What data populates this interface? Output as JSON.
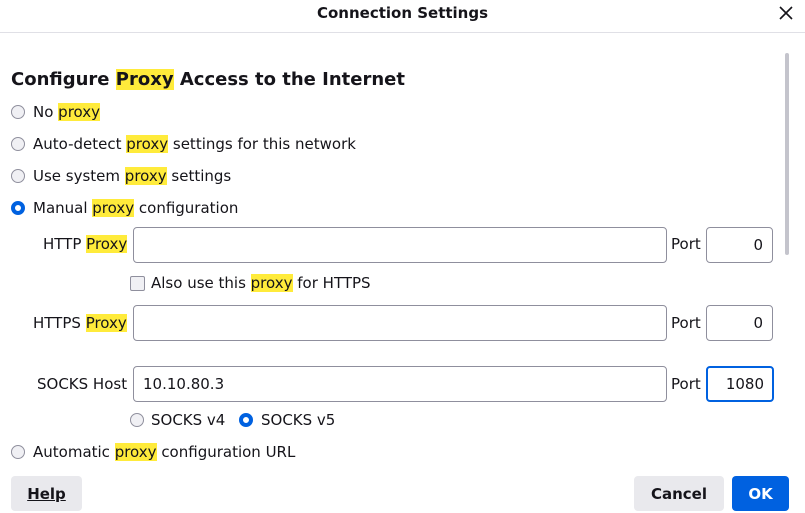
{
  "window": {
    "title": "Connection Settings"
  },
  "heading": {
    "pre": "Configure ",
    "hl": "Proxy",
    "post": " Access to the Internet"
  },
  "options": {
    "no_proxy": {
      "pre": "No ",
      "hl": "proxy",
      "post": "",
      "selected": false
    },
    "auto_detect": {
      "pre": "Auto-detect ",
      "hl": "proxy",
      "post": " settings for this network",
      "selected": false
    },
    "system": {
      "pre": "Use system ",
      "hl": "proxy",
      "post": " settings",
      "selected": false
    },
    "manual": {
      "pre": "Manual ",
      "hl": "proxy",
      "post": " configuration",
      "selected": true
    },
    "auto_url": {
      "pre": "Automatic ",
      "hl": "proxy",
      "post": " configuration URL",
      "selected": false
    }
  },
  "http": {
    "label_pre": "HTTP ",
    "label_hl": "Proxy",
    "host_value": "",
    "port_label": "Port",
    "port_value": "0"
  },
  "also_https": {
    "pre": "Also use this ",
    "hl": "proxy",
    "post": " for HTTPS",
    "checked": false
  },
  "https": {
    "label_pre": "HTTPS ",
    "label_hl": "Proxy",
    "host_value": "",
    "port_label": "Port",
    "port_value": "0"
  },
  "socks": {
    "label": "SOCKS Host",
    "host_value": "10.10.80.3",
    "port_label": "Port",
    "port_value": "1080",
    "v4_label": "SOCKS v4",
    "v5_label": "SOCKS v5",
    "version_selected": "v5"
  },
  "footer": {
    "help": "Help",
    "cancel": "Cancel",
    "ok": "OK"
  },
  "colors": {
    "accent": "#0061e0",
    "highlight": "#ffeb3b",
    "button_bg": "#e9e9ed"
  }
}
